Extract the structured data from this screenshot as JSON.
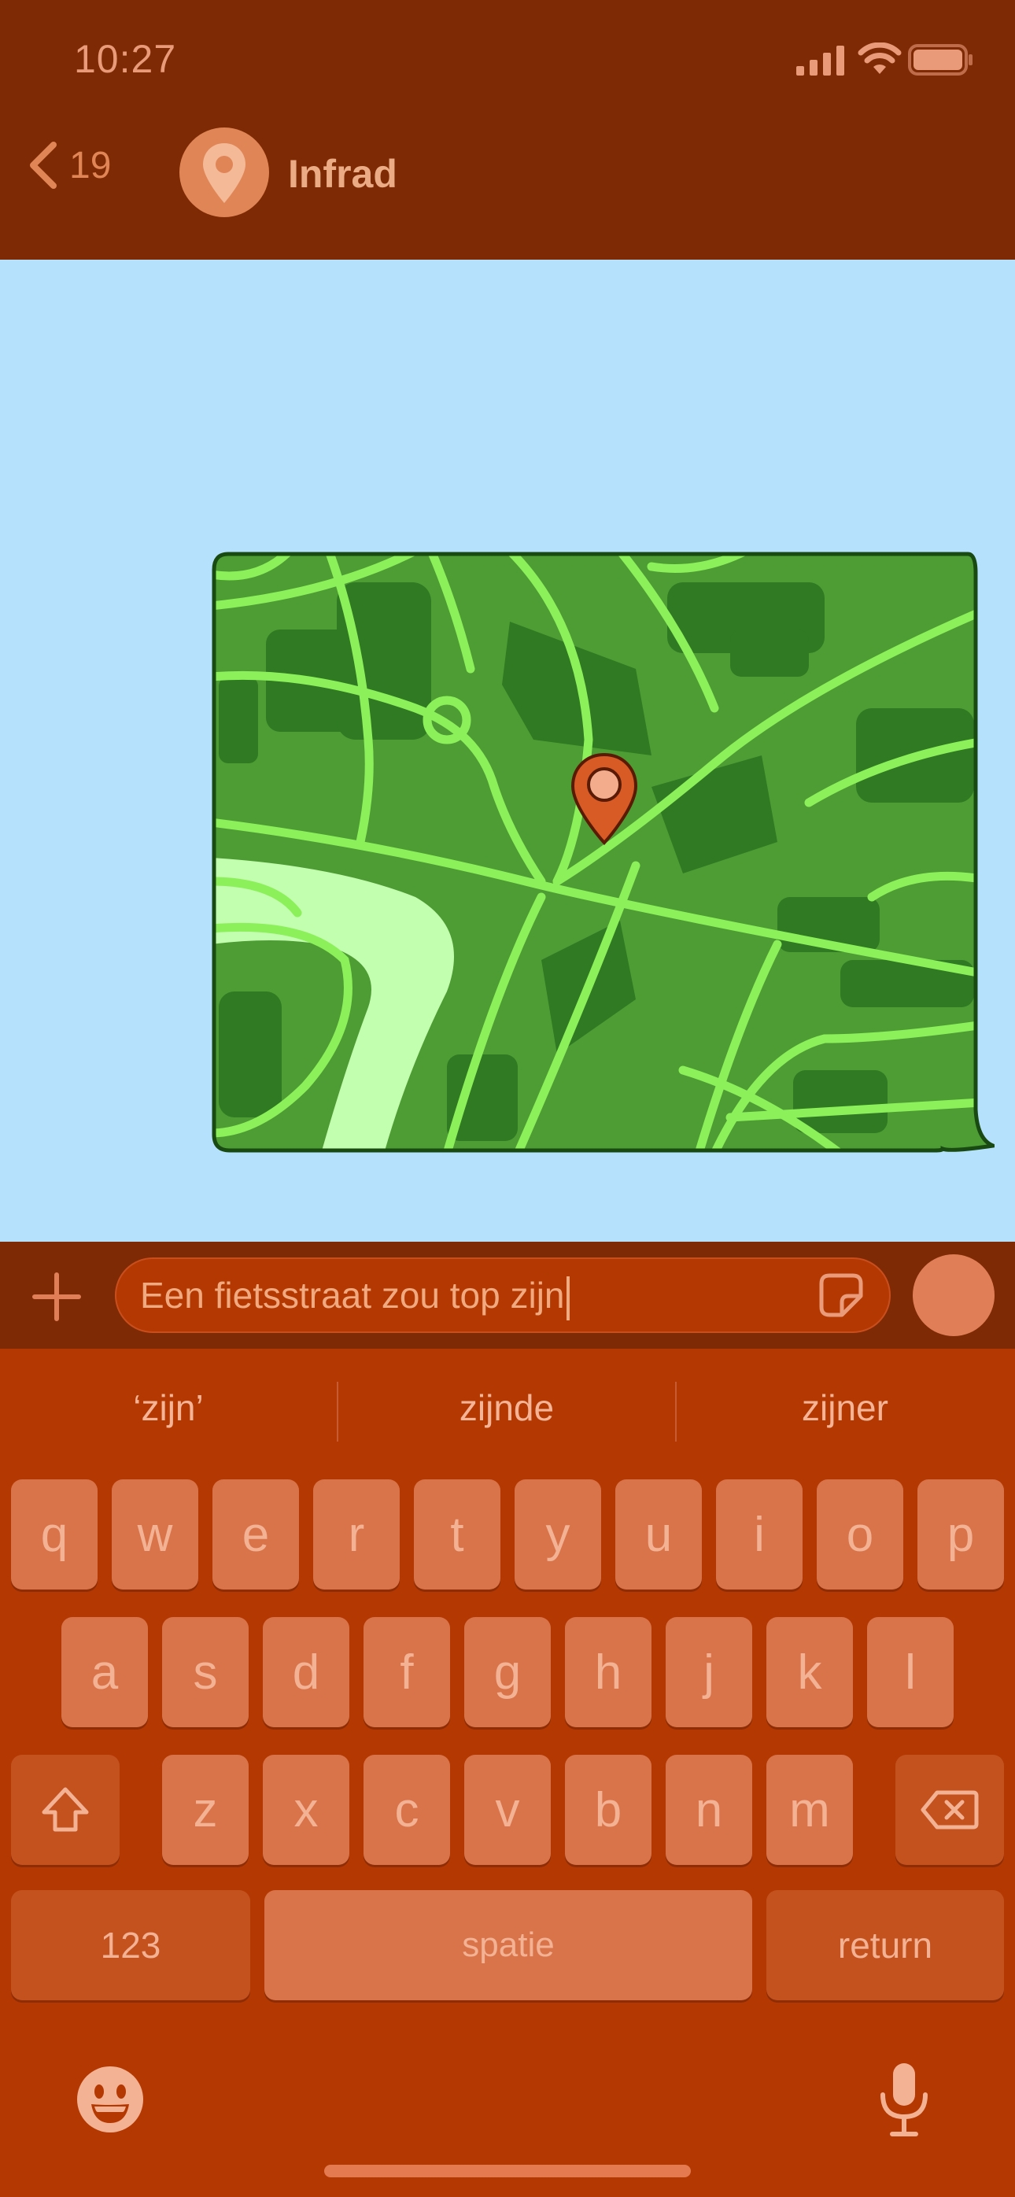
{
  "status_bar": {
    "time": "10:27"
  },
  "header": {
    "back_count": "19",
    "contact_name": "Infrad"
  },
  "composer": {
    "message_text": "Een fietsstraat zou top zijn"
  },
  "keyboard": {
    "suggestions": [
      "‘zijn’",
      "zijnde",
      "zijner"
    ],
    "row1": [
      "q",
      "w",
      "e",
      "r",
      "t",
      "y",
      "u",
      "i",
      "o",
      "p"
    ],
    "row2": [
      "a",
      "s",
      "d",
      "f",
      "g",
      "h",
      "j",
      "k",
      "l"
    ],
    "row3": [
      "z",
      "x",
      "c",
      "v",
      "b",
      "n",
      "m"
    ],
    "numbers_label": "123",
    "space_label": "spatie",
    "return_label": "return"
  },
  "colors": {
    "header_bg": "#7e2a05",
    "chat_bg": "#b6e1fd",
    "keyboard_bg": "#b33802",
    "key_bg": "#d9734a",
    "map_green": "#4e9d34",
    "map_road": "#8cf05a"
  },
  "icons": {
    "status": [
      "signal-icon",
      "wifi-icon",
      "battery-icon"
    ],
    "header": [
      "back-chevron-icon",
      "location-pin-icon"
    ],
    "composer": [
      "plus-icon",
      "sticker-icon"
    ],
    "keyboard": [
      "shift-icon",
      "delete-icon",
      "emoji-icon",
      "microphone-icon"
    ]
  }
}
